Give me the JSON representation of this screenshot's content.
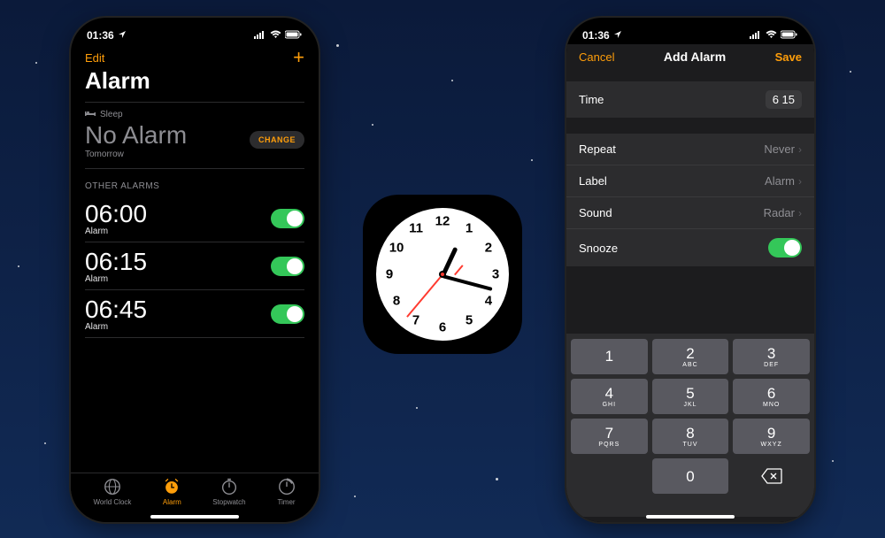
{
  "status": {
    "time": "01:36"
  },
  "left": {
    "edit": "Edit",
    "title": "Alarm",
    "sleep_label": "Sleep",
    "no_alarm": "No Alarm",
    "tomorrow": "Tomorrow",
    "change": "CHANGE",
    "other_label": "OTHER ALARMS",
    "alarms": [
      {
        "time": "06:00",
        "label": "Alarm",
        "on": true
      },
      {
        "time": "06:15",
        "label": "Alarm",
        "on": true
      },
      {
        "time": "06:45",
        "label": "Alarm",
        "on": true
      }
    ],
    "tabs": {
      "world_clock": "World Clock",
      "alarm": "Alarm",
      "stopwatch": "Stopwatch",
      "timer": "Timer"
    }
  },
  "right": {
    "cancel": "Cancel",
    "title": "Add Alarm",
    "save": "Save",
    "time_label": "Time",
    "time_value": "6 15",
    "repeat_label": "Repeat",
    "repeat_value": "Never",
    "label_label": "Label",
    "label_value": "Alarm",
    "sound_label": "Sound",
    "sound_value": "Radar",
    "snooze_label": "Snooze",
    "snooze_on": true,
    "keypad": [
      {
        "n": "1",
        "l": ""
      },
      {
        "n": "2",
        "l": "ABC"
      },
      {
        "n": "3",
        "l": "DEF"
      },
      {
        "n": "4",
        "l": "GHI"
      },
      {
        "n": "5",
        "l": "JKL"
      },
      {
        "n": "6",
        "l": "MNO"
      },
      {
        "n": "7",
        "l": "PQRS"
      },
      {
        "n": "8",
        "l": "TUV"
      },
      {
        "n": "9",
        "l": "WXYZ"
      }
    ],
    "zero": "0"
  },
  "clock": {
    "numbers": [
      "12",
      "1",
      "2",
      "3",
      "4",
      "5",
      "6",
      "7",
      "8",
      "9",
      "10",
      "11"
    ],
    "hour_angle": 25,
    "min_angle": 105,
    "sec_angle": 220
  }
}
